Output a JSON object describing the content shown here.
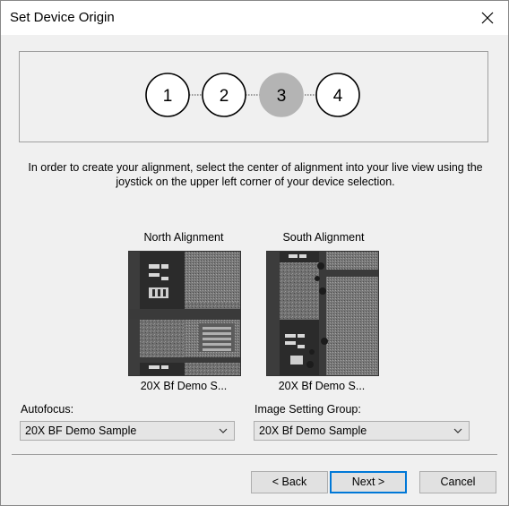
{
  "window": {
    "title": "Set Device Origin"
  },
  "steps": [
    {
      "label": "1",
      "state": "inactive"
    },
    {
      "label": "2",
      "state": "inactive"
    },
    {
      "label": "3",
      "state": "active"
    },
    {
      "label": "4",
      "state": "inactive"
    }
  ],
  "instruction": "In order to create your alignment, select the center of alignment into your live view using the joystick on the upper left corner of your device selection.",
  "north": {
    "title": "North Alignment",
    "caption": "20X Bf Demo S..."
  },
  "south": {
    "title": "South Alignment",
    "caption": "20X Bf Demo S..."
  },
  "autofocus": {
    "label": "Autofocus:",
    "value": "20X BF Demo Sample"
  },
  "image_setting": {
    "label": "Image Setting Group:",
    "value": "20X Bf Demo Sample"
  },
  "buttons": {
    "back": "< Back",
    "next": "Next >",
    "cancel": "Cancel"
  },
  "colors": {
    "active_step": "#b4b4b4",
    "default_button_border": "#0078d7"
  }
}
